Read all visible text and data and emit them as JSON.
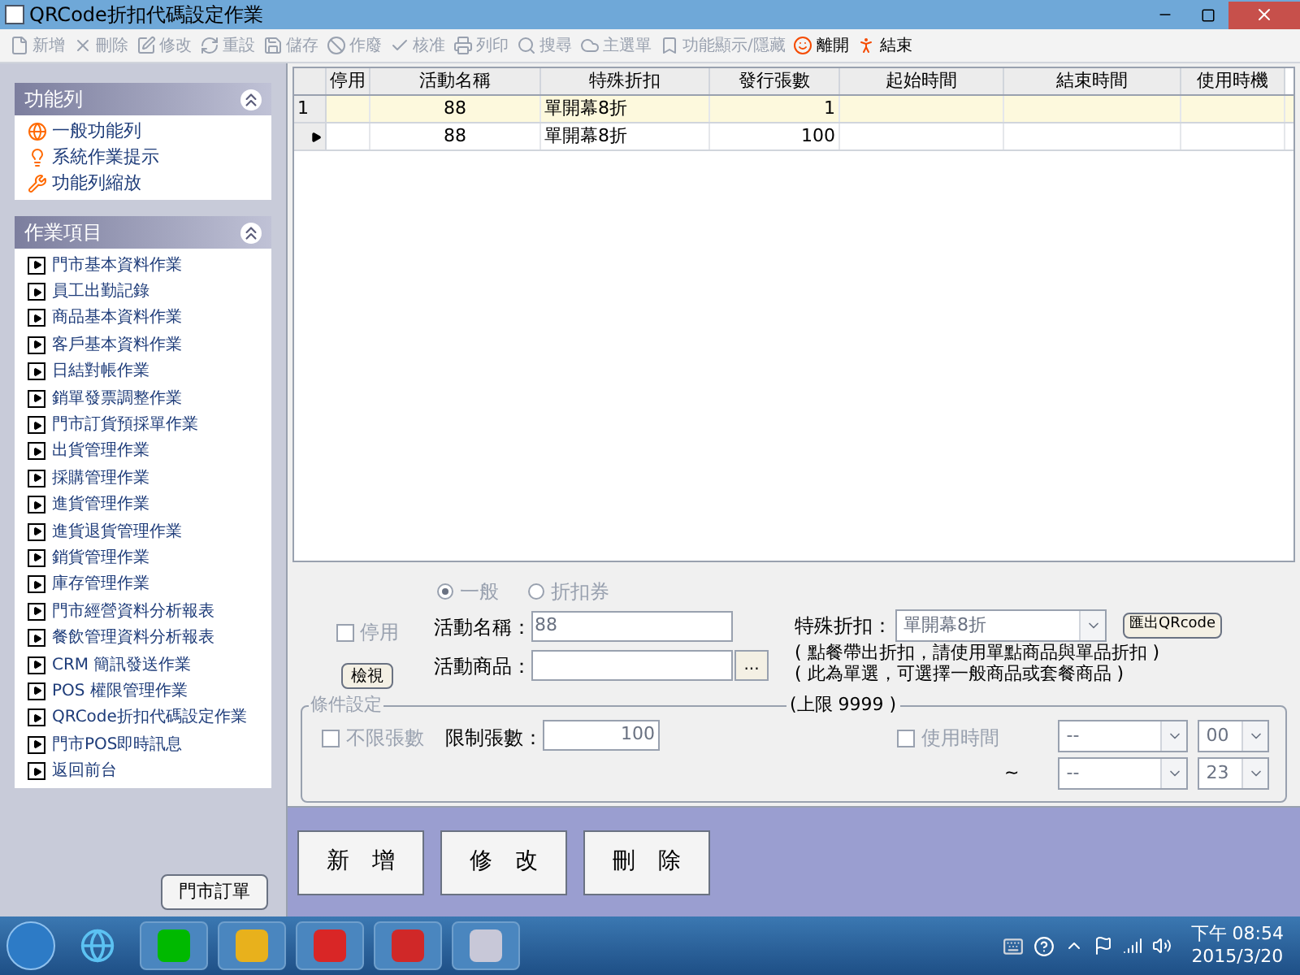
{
  "window": {
    "title": "QRCode折扣代碼設定作業"
  },
  "toolbar": [
    {
      "label": "新增",
      "disabled": true
    },
    {
      "label": "刪除",
      "disabled": true
    },
    {
      "label": "修改",
      "disabled": true
    },
    {
      "label": "重設",
      "disabled": true
    },
    {
      "label": "儲存",
      "disabled": true
    },
    {
      "label": "作廢",
      "disabled": true
    },
    {
      "label": "核准",
      "disabled": true
    },
    {
      "label": "列印",
      "disabled": true
    },
    {
      "label": "搜尋",
      "disabled": true
    },
    {
      "label": "主選單",
      "disabled": true
    },
    {
      "label": "功能顯示/隱藏",
      "disabled": true
    },
    {
      "label": "離開",
      "disabled": false
    },
    {
      "label": "結束",
      "disabled": false
    }
  ],
  "sidebar": {
    "function_panel": {
      "title": "功能列",
      "items": [
        "一般功能列",
        "系統作業提示",
        "功能列縮放"
      ]
    },
    "tasks_panel": {
      "title": "作業項目",
      "items": [
        "門市基本資料作業",
        "員工出勤記錄",
        "商品基本資料作業",
        "客戶基本資料作業",
        "日結對帳作業",
        "銷單發票調整作業",
        "門市訂貨預採單作業",
        "出貨管理作業",
        "採購管理作業",
        "進貨管理作業",
        "進貨退貨管理作業",
        "銷貨管理作業",
        "庫存管理作業",
        "門市經營資料分析報表",
        "餐飲管理資料分析報表",
        "CRM 簡訊發送作業",
        "POS 權限管理作業",
        "QRCode折扣代碼設定作業",
        "門市POS即時訊息",
        "返回前台"
      ]
    },
    "bottom_button": "門市訂單"
  },
  "table": {
    "columns": [
      "停用",
      "活動名稱",
      "特殊折扣",
      "發行張數",
      "起始時間",
      "結束時間",
      "使用時機"
    ],
    "rows": [
      {
        "row_label": "1",
        "selected": true,
        "current": false,
        "cells": [
          "",
          "88",
          "單開幕8折",
          "1",
          "",
          "",
          ""
        ]
      },
      {
        "row_label": "",
        "selected": false,
        "current": true,
        "cells": [
          "",
          "88",
          "單開幕8折",
          "100",
          "",
          "",
          ""
        ]
      }
    ]
  },
  "form": {
    "type_options": [
      {
        "label": "一般",
        "selected": true
      },
      {
        "label": "折扣券",
        "selected": false
      }
    ],
    "disabled_checkbox": {
      "label": "停用",
      "checked": false
    },
    "view_button": "檢視",
    "name_label": "活動名稱：",
    "name_value": "88",
    "product_label": "活動商品：",
    "browse_button": "...",
    "discount_label": "特殊折扣：",
    "discount_value": "單開幕8折",
    "export_button": "匯出QRcode",
    "notes": [
      "( 點餐帶出折扣，請使用單點商品與單品折扣 )",
      "( 此為單選，可選擇一般商品或套餐商品 )"
    ],
    "conditions": {
      "title": "條件設定",
      "limit_note": "(上限 9999 )",
      "unlimited_checkbox": {
        "label": "不限張數",
        "checked": false
      },
      "limit_label": "限制張數：",
      "limit_value": "100",
      "time_checkbox": {
        "label": "使用時間",
        "checked": false
      },
      "start_date": "--",
      "start_hour": "00",
      "range_sign": "~",
      "end_date": "--",
      "end_hour": "23"
    }
  },
  "action_buttons": [
    "新　增",
    "修　改",
    "刪　除"
  ],
  "taskbar": {
    "time": "下午 08:54",
    "date": "2015/3/20"
  }
}
